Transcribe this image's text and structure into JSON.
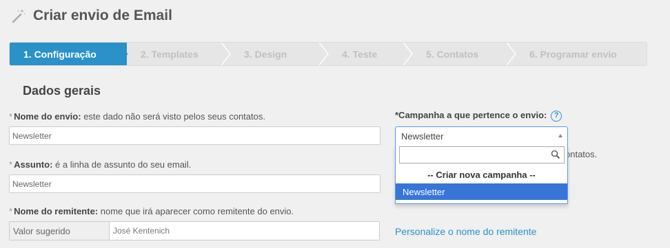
{
  "header": {
    "title": "Criar envio de Email"
  },
  "steps": [
    {
      "label": "1. Configuração",
      "active": true
    },
    {
      "label": "2. Templates"
    },
    {
      "label": "3. Design"
    },
    {
      "label": "4. Teste"
    },
    {
      "label": "5. Contatos"
    },
    {
      "label": "6. Programar envio"
    }
  ],
  "section": {
    "title": "Dados gerais"
  },
  "fields": {
    "required_mark": "*",
    "envio_nome": {
      "label": "Nome do envio:",
      "hint": " este dado não será visto pelos seus contatos.",
      "value": "Newsletter"
    },
    "assunto": {
      "label": "Assunto:",
      "hint": " é a linha de assunto do seu email.",
      "value": "Newsletter"
    },
    "remetente": {
      "label": "Nome do remitente:",
      "hint": " nome que irá aparecer como remitente do envio.",
      "addon": "Valor sugerido",
      "value": "José Kentenich"
    },
    "campanha": {
      "label": "*Campanha a que pertence o envio:",
      "help": "?",
      "selected": "Newsletter"
    }
  },
  "dropdown": {
    "search_value": "",
    "options": [
      "-- Criar nova campanha --",
      "Newsletter"
    ]
  },
  "background_text": "ontatos.",
  "links": {
    "personalize": "Personalize o nome do remitente"
  },
  "colors": {
    "accent": "#2a91c9",
    "highlight": "#3875d7"
  }
}
